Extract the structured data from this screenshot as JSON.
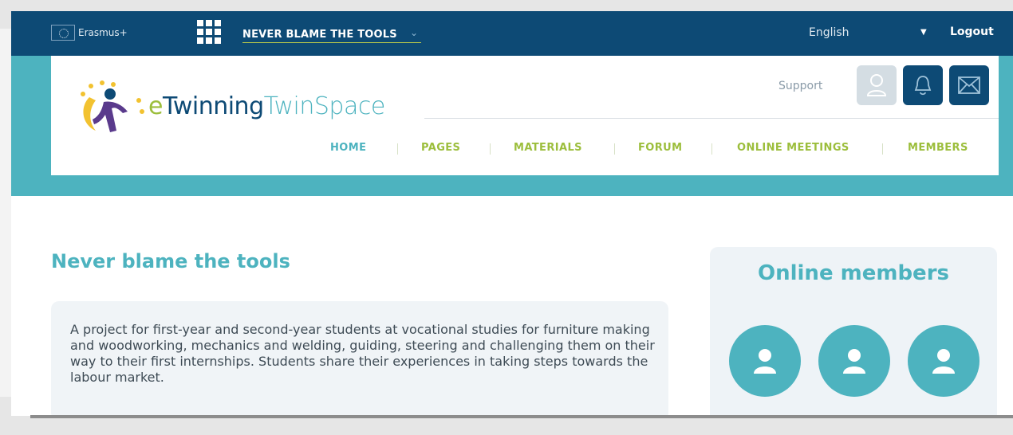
{
  "topbar": {
    "brand": "Erasmus+",
    "project_name": "NEVER BLAME THE TOOLS",
    "language": "English",
    "logout": "Logout"
  },
  "header": {
    "logo_e": "e",
    "logo_twinning": "Twinning",
    "logo_twinspace": "TwinSpace",
    "support": "Support"
  },
  "nav": {
    "items": [
      {
        "label": "HOME"
      },
      {
        "label": "PAGES"
      },
      {
        "label": "MATERIALS"
      },
      {
        "label": "FORUM"
      },
      {
        "label": "ONLINE MEETINGS"
      },
      {
        "label": "MEMBERS"
      }
    ]
  },
  "main": {
    "title": "Never blame the tools",
    "description": "A project for first-year and second-year students at vocational studies for furniture making and woodworking, mechanics and welding, guiding, steering and challenging them on their way to their first internships. Students share their experiences in taking steps towards the labour market."
  },
  "sidebar": {
    "online_members_title": "Online members"
  },
  "colors": {
    "topbar": "#0d4a75",
    "teal": "#4db3bf",
    "green": "#9cbe3c"
  }
}
